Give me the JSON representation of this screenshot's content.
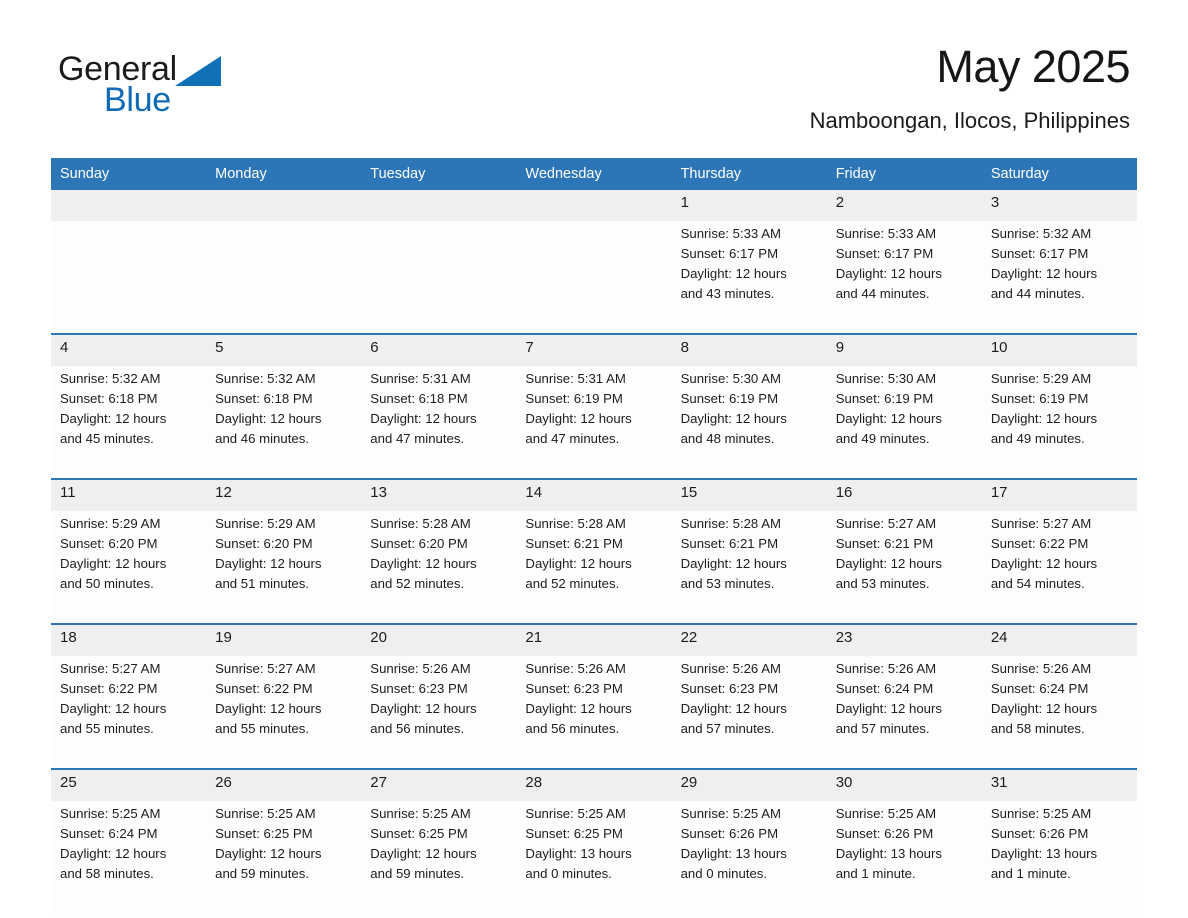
{
  "brand": {
    "name_part1": "General",
    "name_part2": "Blue",
    "triangle_color": "#1070b8",
    "blue_color": "#0f6bb5"
  },
  "header": {
    "month_title": "May 2025",
    "location": "Namboongan, Ilocos, Philippines"
  },
  "theme": {
    "header_blue": "#2c76b8",
    "daynum_gray": "#efefef",
    "cell_white": "#fdfdfd",
    "separator_blue": "#2c76b8"
  },
  "weekday_headers": [
    "Sunday",
    "Monday",
    "Tuesday",
    "Wednesday",
    "Thursday",
    "Friday",
    "Saturday"
  ],
  "weeks": [
    {
      "days": [
        {
          "num": "",
          "sunrise": "",
          "sunset": "",
          "daylight_1": "",
          "daylight_2": "",
          "empty": true
        },
        {
          "num": "",
          "sunrise": "",
          "sunset": "",
          "daylight_1": "",
          "daylight_2": "",
          "empty": true
        },
        {
          "num": "",
          "sunrise": "",
          "sunset": "",
          "daylight_1": "",
          "daylight_2": "",
          "empty": true
        },
        {
          "num": "",
          "sunrise": "",
          "sunset": "",
          "daylight_1": "",
          "daylight_2": "",
          "empty": true
        },
        {
          "num": "1",
          "sunrise": "Sunrise: 5:33 AM",
          "sunset": "Sunset: 6:17 PM",
          "daylight_1": "Daylight: 12 hours",
          "daylight_2": "and 43 minutes.",
          "empty": false
        },
        {
          "num": "2",
          "sunrise": "Sunrise: 5:33 AM",
          "sunset": "Sunset: 6:17 PM",
          "daylight_1": "Daylight: 12 hours",
          "daylight_2": "and 44 minutes.",
          "empty": false
        },
        {
          "num": "3",
          "sunrise": "Sunrise: 5:32 AM",
          "sunset": "Sunset: 6:17 PM",
          "daylight_1": "Daylight: 12 hours",
          "daylight_2": "and 44 minutes.",
          "empty": false
        }
      ]
    },
    {
      "days": [
        {
          "num": "4",
          "sunrise": "Sunrise: 5:32 AM",
          "sunset": "Sunset: 6:18 PM",
          "daylight_1": "Daylight: 12 hours",
          "daylight_2": "and 45 minutes.",
          "empty": false
        },
        {
          "num": "5",
          "sunrise": "Sunrise: 5:32 AM",
          "sunset": "Sunset: 6:18 PM",
          "daylight_1": "Daylight: 12 hours",
          "daylight_2": "and 46 minutes.",
          "empty": false
        },
        {
          "num": "6",
          "sunrise": "Sunrise: 5:31 AM",
          "sunset": "Sunset: 6:18 PM",
          "daylight_1": "Daylight: 12 hours",
          "daylight_2": "and 47 minutes.",
          "empty": false
        },
        {
          "num": "7",
          "sunrise": "Sunrise: 5:31 AM",
          "sunset": "Sunset: 6:19 PM",
          "daylight_1": "Daylight: 12 hours",
          "daylight_2": "and 47 minutes.",
          "empty": false
        },
        {
          "num": "8",
          "sunrise": "Sunrise: 5:30 AM",
          "sunset": "Sunset: 6:19 PM",
          "daylight_1": "Daylight: 12 hours",
          "daylight_2": "and 48 minutes.",
          "empty": false
        },
        {
          "num": "9",
          "sunrise": "Sunrise: 5:30 AM",
          "sunset": "Sunset: 6:19 PM",
          "daylight_1": "Daylight: 12 hours",
          "daylight_2": "and 49 minutes.",
          "empty": false
        },
        {
          "num": "10",
          "sunrise": "Sunrise: 5:29 AM",
          "sunset": "Sunset: 6:19 PM",
          "daylight_1": "Daylight: 12 hours",
          "daylight_2": "and 49 minutes.",
          "empty": false
        }
      ]
    },
    {
      "days": [
        {
          "num": "11",
          "sunrise": "Sunrise: 5:29 AM",
          "sunset": "Sunset: 6:20 PM",
          "daylight_1": "Daylight: 12 hours",
          "daylight_2": "and 50 minutes.",
          "empty": false
        },
        {
          "num": "12",
          "sunrise": "Sunrise: 5:29 AM",
          "sunset": "Sunset: 6:20 PM",
          "daylight_1": "Daylight: 12 hours",
          "daylight_2": "and 51 minutes.",
          "empty": false
        },
        {
          "num": "13",
          "sunrise": "Sunrise: 5:28 AM",
          "sunset": "Sunset: 6:20 PM",
          "daylight_1": "Daylight: 12 hours",
          "daylight_2": "and 52 minutes.",
          "empty": false
        },
        {
          "num": "14",
          "sunrise": "Sunrise: 5:28 AM",
          "sunset": "Sunset: 6:21 PM",
          "daylight_1": "Daylight: 12 hours",
          "daylight_2": "and 52 minutes.",
          "empty": false
        },
        {
          "num": "15",
          "sunrise": "Sunrise: 5:28 AM",
          "sunset": "Sunset: 6:21 PM",
          "daylight_1": "Daylight: 12 hours",
          "daylight_2": "and 53 minutes.",
          "empty": false
        },
        {
          "num": "16",
          "sunrise": "Sunrise: 5:27 AM",
          "sunset": "Sunset: 6:21 PM",
          "daylight_1": "Daylight: 12 hours",
          "daylight_2": "and 53 minutes.",
          "empty": false
        },
        {
          "num": "17",
          "sunrise": "Sunrise: 5:27 AM",
          "sunset": "Sunset: 6:22 PM",
          "daylight_1": "Daylight: 12 hours",
          "daylight_2": "and 54 minutes.",
          "empty": false
        }
      ]
    },
    {
      "days": [
        {
          "num": "18",
          "sunrise": "Sunrise: 5:27 AM",
          "sunset": "Sunset: 6:22 PM",
          "daylight_1": "Daylight: 12 hours",
          "daylight_2": "and 55 minutes.",
          "empty": false
        },
        {
          "num": "19",
          "sunrise": "Sunrise: 5:27 AM",
          "sunset": "Sunset: 6:22 PM",
          "daylight_1": "Daylight: 12 hours",
          "daylight_2": "and 55 minutes.",
          "empty": false
        },
        {
          "num": "20",
          "sunrise": "Sunrise: 5:26 AM",
          "sunset": "Sunset: 6:23 PM",
          "daylight_1": "Daylight: 12 hours",
          "daylight_2": "and 56 minutes.",
          "empty": false
        },
        {
          "num": "21",
          "sunrise": "Sunrise: 5:26 AM",
          "sunset": "Sunset: 6:23 PM",
          "daylight_1": "Daylight: 12 hours",
          "daylight_2": "and 56 minutes.",
          "empty": false
        },
        {
          "num": "22",
          "sunrise": "Sunrise: 5:26 AM",
          "sunset": "Sunset: 6:23 PM",
          "daylight_1": "Daylight: 12 hours",
          "daylight_2": "and 57 minutes.",
          "empty": false
        },
        {
          "num": "23",
          "sunrise": "Sunrise: 5:26 AM",
          "sunset": "Sunset: 6:24 PM",
          "daylight_1": "Daylight: 12 hours",
          "daylight_2": "and 57 minutes.",
          "empty": false
        },
        {
          "num": "24",
          "sunrise": "Sunrise: 5:26 AM",
          "sunset": "Sunset: 6:24 PM",
          "daylight_1": "Daylight: 12 hours",
          "daylight_2": "and 58 minutes.",
          "empty": false
        }
      ]
    },
    {
      "days": [
        {
          "num": "25",
          "sunrise": "Sunrise: 5:25 AM",
          "sunset": "Sunset: 6:24 PM",
          "daylight_1": "Daylight: 12 hours",
          "daylight_2": "and 58 minutes.",
          "empty": false
        },
        {
          "num": "26",
          "sunrise": "Sunrise: 5:25 AM",
          "sunset": "Sunset: 6:25 PM",
          "daylight_1": "Daylight: 12 hours",
          "daylight_2": "and 59 minutes.",
          "empty": false
        },
        {
          "num": "27",
          "sunrise": "Sunrise: 5:25 AM",
          "sunset": "Sunset: 6:25 PM",
          "daylight_1": "Daylight: 12 hours",
          "daylight_2": "and 59 minutes.",
          "empty": false
        },
        {
          "num": "28",
          "sunrise": "Sunrise: 5:25 AM",
          "sunset": "Sunset: 6:25 PM",
          "daylight_1": "Daylight: 13 hours",
          "daylight_2": "and 0 minutes.",
          "empty": false
        },
        {
          "num": "29",
          "sunrise": "Sunrise: 5:25 AM",
          "sunset": "Sunset: 6:26 PM",
          "daylight_1": "Daylight: 13 hours",
          "daylight_2": "and 0 minutes.",
          "empty": false
        },
        {
          "num": "30",
          "sunrise": "Sunrise: 5:25 AM",
          "sunset": "Sunset: 6:26 PM",
          "daylight_1": "Daylight: 13 hours",
          "daylight_2": "and 1 minute.",
          "empty": false
        },
        {
          "num": "31",
          "sunrise": "Sunrise: 5:25 AM",
          "sunset": "Sunset: 6:26 PM",
          "daylight_1": "Daylight: 13 hours",
          "daylight_2": "and 1 minute.",
          "empty": false
        }
      ]
    }
  ]
}
